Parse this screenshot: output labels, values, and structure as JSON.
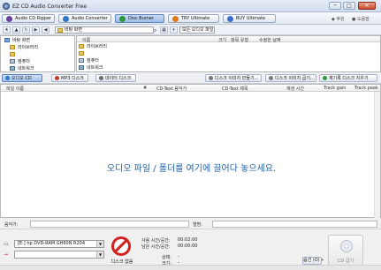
{
  "window": {
    "title": "EZ CD Audio Converter Free",
    "min": "─",
    "max": "□",
    "close": "✕"
  },
  "modes": [
    {
      "label": "Audio CD Ripper",
      "color": "#6b3fa0"
    },
    {
      "label": "Audio Converter",
      "color": "#2f78c4"
    },
    {
      "label": "Disc Burner",
      "color": "#2a9a3a",
      "active": true
    },
    {
      "label": "TRY Ultimate",
      "color": "#e07b1a"
    },
    {
      "label": "BUY Ultimate",
      "color": "#3b6fd0"
    }
  ],
  "header_links": {
    "support": "후원",
    "help": "도움말"
  },
  "address": {
    "path": "바탕 화면",
    "filter": "모든 오디오 파일"
  },
  "tree": {
    "items": [
      {
        "label": "바탕 화면",
        "icon": "folder-blue"
      },
      {
        "label": "라이브러리",
        "icon": "library"
      },
      {
        "label": "",
        "icon": "user"
      },
      {
        "label": "컴퓨터",
        "icon": "computer"
      },
      {
        "label": "네트워크",
        "icon": "network"
      }
    ]
  },
  "filelist": {
    "columns": [
      "이름",
      "크기",
      "항목 유형",
      "수정한 날짜"
    ],
    "rows": [
      {
        "label": "라이브러리",
        "icon": "library"
      },
      {
        "label": "",
        "icon": "user"
      },
      {
        "label": "컴퓨터",
        "icon": "computer"
      },
      {
        "label": "네트워크",
        "icon": "network"
      }
    ]
  },
  "disc_toolbar": {
    "modes": [
      {
        "label": "오디오 CD",
        "color": "#2f78c4",
        "active": true
      },
      {
        "label": "MP3 디스크",
        "color": "#c0392b"
      },
      {
        "label": "데이터 디스크",
        "color": "#6b6b6b"
      }
    ],
    "actions": [
      {
        "label": "디스크 이미지 만들기...",
        "color": "#7a7a7a"
      },
      {
        "label": "디스크 이미지 굽기...",
        "color": "#7a7a7a"
      },
      {
        "label": "재기록 디스크 지우기",
        "color": "#2a9a3a"
      }
    ]
  },
  "tracks": {
    "columns": [
      "파일 이름",
      "#",
      "CD-Text 음악가",
      "CD-Text 제목",
      "재생 시간",
      "Track gain",
      "Track peak"
    ],
    "drop_message": "오디오 파일 / 폴더를 여기에 끌어다 놓으세요."
  },
  "strip": {
    "left_label": "음악가:",
    "right_label": "앨범:"
  },
  "bottom": {
    "drive": "[E:] hp DVD-RAM GH60N R204",
    "no_disc": "디스크 없음",
    "used_label": "사용 시간/공간:",
    "used_value": "00:02:00",
    "free_label": "남은 시간/공간:",
    "free_value": "00:00:00",
    "status_label": "상태:",
    "status_value": "-",
    "size_label": "크기:",
    "size_value": "-",
    "options": "옵션 (O) »",
    "burn": "CD 굽기"
  }
}
